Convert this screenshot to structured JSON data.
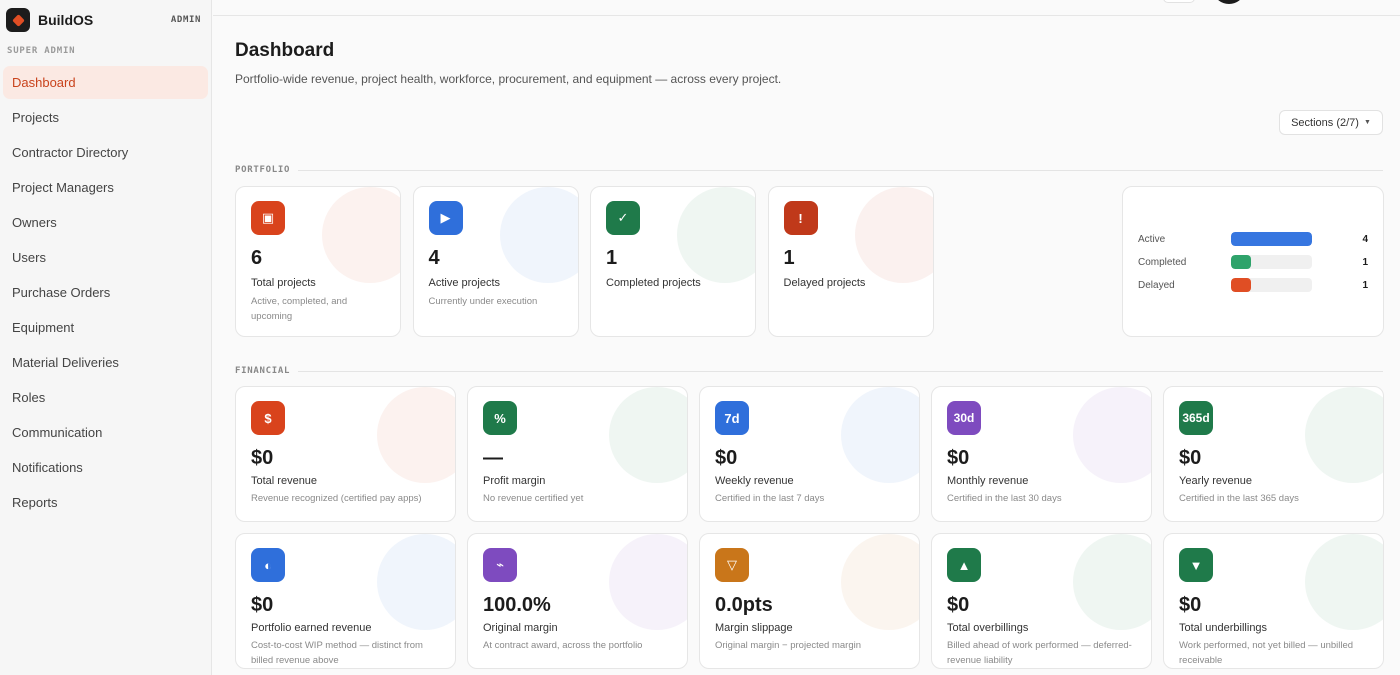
{
  "brand": {
    "name": "BuildOS",
    "badge": "ADMIN"
  },
  "sidebar": {
    "section": "SUPER ADMIN",
    "items": [
      {
        "label": "Dashboard",
        "active": true
      },
      {
        "label": "Projects"
      },
      {
        "label": "Contractor Directory"
      },
      {
        "label": "Project Managers"
      },
      {
        "label": "Owners"
      },
      {
        "label": "Users"
      },
      {
        "label": "Purchase Orders"
      },
      {
        "label": "Equipment"
      },
      {
        "label": "Material Deliveries"
      },
      {
        "label": "Roles"
      },
      {
        "label": "Communication"
      },
      {
        "label": "Notifications"
      },
      {
        "label": "Reports"
      }
    ]
  },
  "header": {
    "title": "Dashboard",
    "description": "Portfolio-wide revenue, project health, workforce, procurement, and equipment — across every project.",
    "sections_button": "Sections (2/7)"
  },
  "portfolio": {
    "label": "PORTFOLIO",
    "cards": [
      {
        "icon": "▣",
        "icon_name": "project-box-icon",
        "color": "#d9431c",
        "value": "6",
        "label": "Total projects",
        "sub": "Active, completed, and upcoming"
      },
      {
        "icon": "▶",
        "icon_name": "play-icon",
        "color": "#2f6fdb",
        "value": "4",
        "label": "Active projects",
        "sub": "Currently under execution"
      },
      {
        "icon": "✓",
        "icon_name": "check-icon",
        "color": "#1f7a4a",
        "value": "1",
        "label": "Completed projects",
        "sub": ""
      },
      {
        "icon": "!",
        "icon_name": "alert-icon",
        "color": "#c0391a",
        "value": "1",
        "label": "Delayed projects",
        "sub": ""
      }
    ],
    "status": [
      {
        "name": "Active",
        "count": "4",
        "fraction": 1.0,
        "color": "#3676e0"
      },
      {
        "name": "Completed",
        "count": "1",
        "fraction": 0.25,
        "color": "#2fa36b"
      },
      {
        "name": "Delayed",
        "count": "1",
        "fraction": 0.25,
        "color": "#e04e24"
      }
    ]
  },
  "financial": {
    "label": "FINANCIAL",
    "cards": [
      {
        "icon": "$",
        "icon_name": "dollar-icon",
        "color": "#d9431c",
        "value": "$0",
        "label": "Total revenue",
        "sub": "Revenue recognized (certified pay apps)"
      },
      {
        "icon": "%",
        "icon_name": "percent-icon",
        "color": "#1f7a4a",
        "value": "—",
        "label": "Profit margin",
        "sub": "No revenue certified yet"
      },
      {
        "icon": "7d",
        "icon_name": "calendar-7d-icon",
        "color": "#2f6fdb",
        "value": "$0",
        "label": "Weekly revenue",
        "sub": "Certified in the last 7 days"
      },
      {
        "icon": "30d",
        "icon_name": "calendar-30d-icon",
        "color": "#7e4bbf",
        "value": "$0",
        "label": "Monthly revenue",
        "sub": "Certified in the last 30 days"
      },
      {
        "icon": "365d",
        "icon_name": "calendar-365d-icon",
        "color": "#1f7a4a",
        "value": "$0",
        "label": "Yearly revenue",
        "sub": "Certified in the last 365 days"
      },
      {
        "icon": "◐",
        "icon_name": "half-circle-icon",
        "color": "#2f6fdb",
        "value": "$0",
        "label": "Portfolio earned revenue",
        "sub": "Cost-to-cost WIP method — distinct from billed revenue above"
      },
      {
        "icon": "⌁",
        "icon_name": "trend-icon",
        "color": "#7e4bbf",
        "value": "100.0%",
        "label": "Original margin",
        "sub": "At contract award, across the portfolio"
      },
      {
        "icon": "▽",
        "icon_name": "triangle-down-outline-icon",
        "color": "#c9761a",
        "value": "0.0pts",
        "label": "Margin slippage",
        "sub": "Original margin − projected margin"
      },
      {
        "icon": "▲",
        "icon_name": "triangle-up-icon",
        "color": "#1f7a4a",
        "value": "$0",
        "label": "Total overbillings",
        "sub": "Billed ahead of work performed — deferred-revenue liability"
      },
      {
        "icon": "▼",
        "icon_name": "triangle-down-icon",
        "color": "#1f7a4a",
        "value": "$0",
        "label": "Total underbillings",
        "sub": "Work performed, not yet billed — unbilled receivable"
      }
    ]
  }
}
